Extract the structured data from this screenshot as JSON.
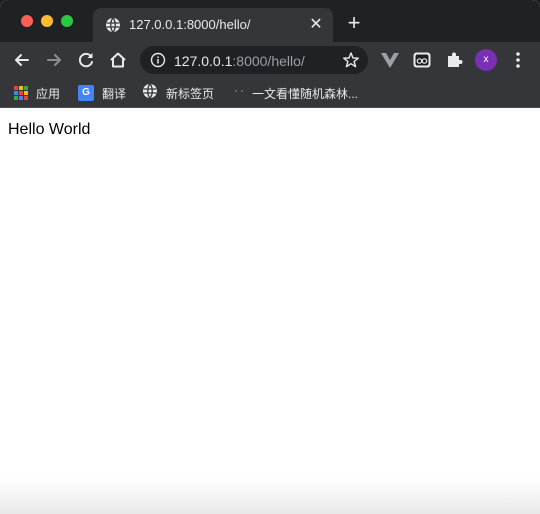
{
  "tab": {
    "title": "127.0.0.1:8000/hello/",
    "close_glyph": "✕",
    "new_tab_glyph": "+"
  },
  "omnibox": {
    "url_host": "127.0.0.1",
    "url_rest": ":8000/hello/"
  },
  "toolbar": {
    "avatar_letter": "x",
    "colors": {
      "avatar": "#7b2fb5",
      "tabstrip": "#202124",
      "toolbar": "#35363a"
    }
  },
  "bookmarks": {
    "items": [
      {
        "label": "应用",
        "icon": "apps-grid-icon"
      },
      {
        "label": "翻译",
        "icon": "google-translate-icon"
      },
      {
        "label": "新标签页",
        "icon": "globe-icon"
      },
      {
        "label": "一文看懂随机森林...",
        "icon": "dots-icon"
      }
    ]
  },
  "page": {
    "content": "Hello World"
  }
}
